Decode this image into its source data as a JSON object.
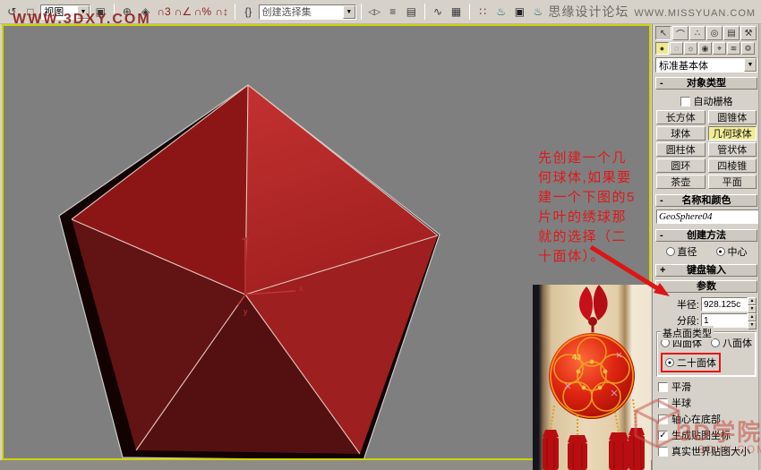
{
  "header": {
    "forum_name": "思缘设计论坛",
    "forum_url": "WWW.MISSYUAN.COM"
  },
  "watermarks": {
    "top": "WWW.3DXY.COM",
    "logo_title": "3D学院",
    "logo_url": "3DXY.COM"
  },
  "toolbar": {
    "view_dropdown": "视图",
    "selection_set_dropdown": "创建选择集",
    "icons": {
      "undo": "↺",
      "region": "□",
      "pivot": "▣",
      "manipulate": "⊕",
      "package": "◈",
      "snap3": "∩3",
      "snapangle": "∩∠",
      "snappct": "∩%",
      "snapspin": "∩↕",
      "namedsets": "{}",
      "mirror": "◁▷",
      "align": "≡",
      "layers": "▤",
      "curve": "∿",
      "schematic": "▦",
      "material": "∷",
      "rendersetup": "♨",
      "renderframe": "▣",
      "quickrender": "♨",
      "dropdown_arrow": "▼",
      "spin_up": "▲",
      "spin_down": "▼"
    }
  },
  "annotation": {
    "line1": "先创建一个几",
    "line2": "何球体,如果要",
    "line3": "建一个下图的5",
    "line4": "片叶的绣球那",
    "line5": "就的选择（二",
    "line6": "十面体）。"
  },
  "panel": {
    "tabs": {
      "create": "↖",
      "modify": "⌒",
      "hierarchy": "∴",
      "motion": "◎",
      "display": "▤",
      "utilities": "⚒"
    },
    "categories": {
      "geometry": "●",
      "shapes": "◌",
      "lights": "☼",
      "cameras": "◉",
      "helpers": "⌖",
      "spacewarps": "≋",
      "systems": "⚙"
    },
    "primitive_dropdown": "标准基本体",
    "object_type": {
      "title": "对象类型",
      "collapse": "-",
      "autogrid": "自动栅格",
      "buttons": [
        "长方体",
        "圆锥体",
        "球体",
        "几何球体",
        "圆柱体",
        "管状体",
        "圆环",
        "四棱锥",
        "茶壶",
        "平面"
      ],
      "active_button": "几何球体"
    },
    "name_color": {
      "title": "名称和颜色",
      "collapse": "-",
      "name": "GeoSphere04",
      "swatch_color": "#c41414"
    },
    "creation": {
      "title": "创建方法",
      "collapse": "-",
      "opt1": {
        "label": "直径",
        "dot": ""
      },
      "opt2": {
        "label": "中心",
        "dot": "●"
      }
    },
    "keyboard": {
      "title": "键盘输入",
      "collapse": "+"
    },
    "params": {
      "title": "参数",
      "collapse": "-",
      "radius_label": "半径:",
      "radius_value": "928.125c",
      "segments_label": "分段:",
      "segments_value": "1",
      "group_label": "基点面类型",
      "base1": {
        "label": "四面体",
        "dot": ""
      },
      "base2": {
        "label": "八面体",
        "dot": ""
      },
      "base3": {
        "label": "二十面体",
        "dot": "●"
      },
      "cb1": {
        "label": "平滑",
        "mark": ""
      },
      "cb2": {
        "label": "半球",
        "mark": ""
      },
      "cb3": {
        "label": "轴心在底部",
        "mark": ""
      },
      "cb4": {
        "label": "生成贴图坐标",
        "mark": "✓"
      },
      "cb5": {
        "label": "真实世界贴图大小",
        "mark": ""
      }
    }
  },
  "ornament": {
    "number": "43"
  }
}
